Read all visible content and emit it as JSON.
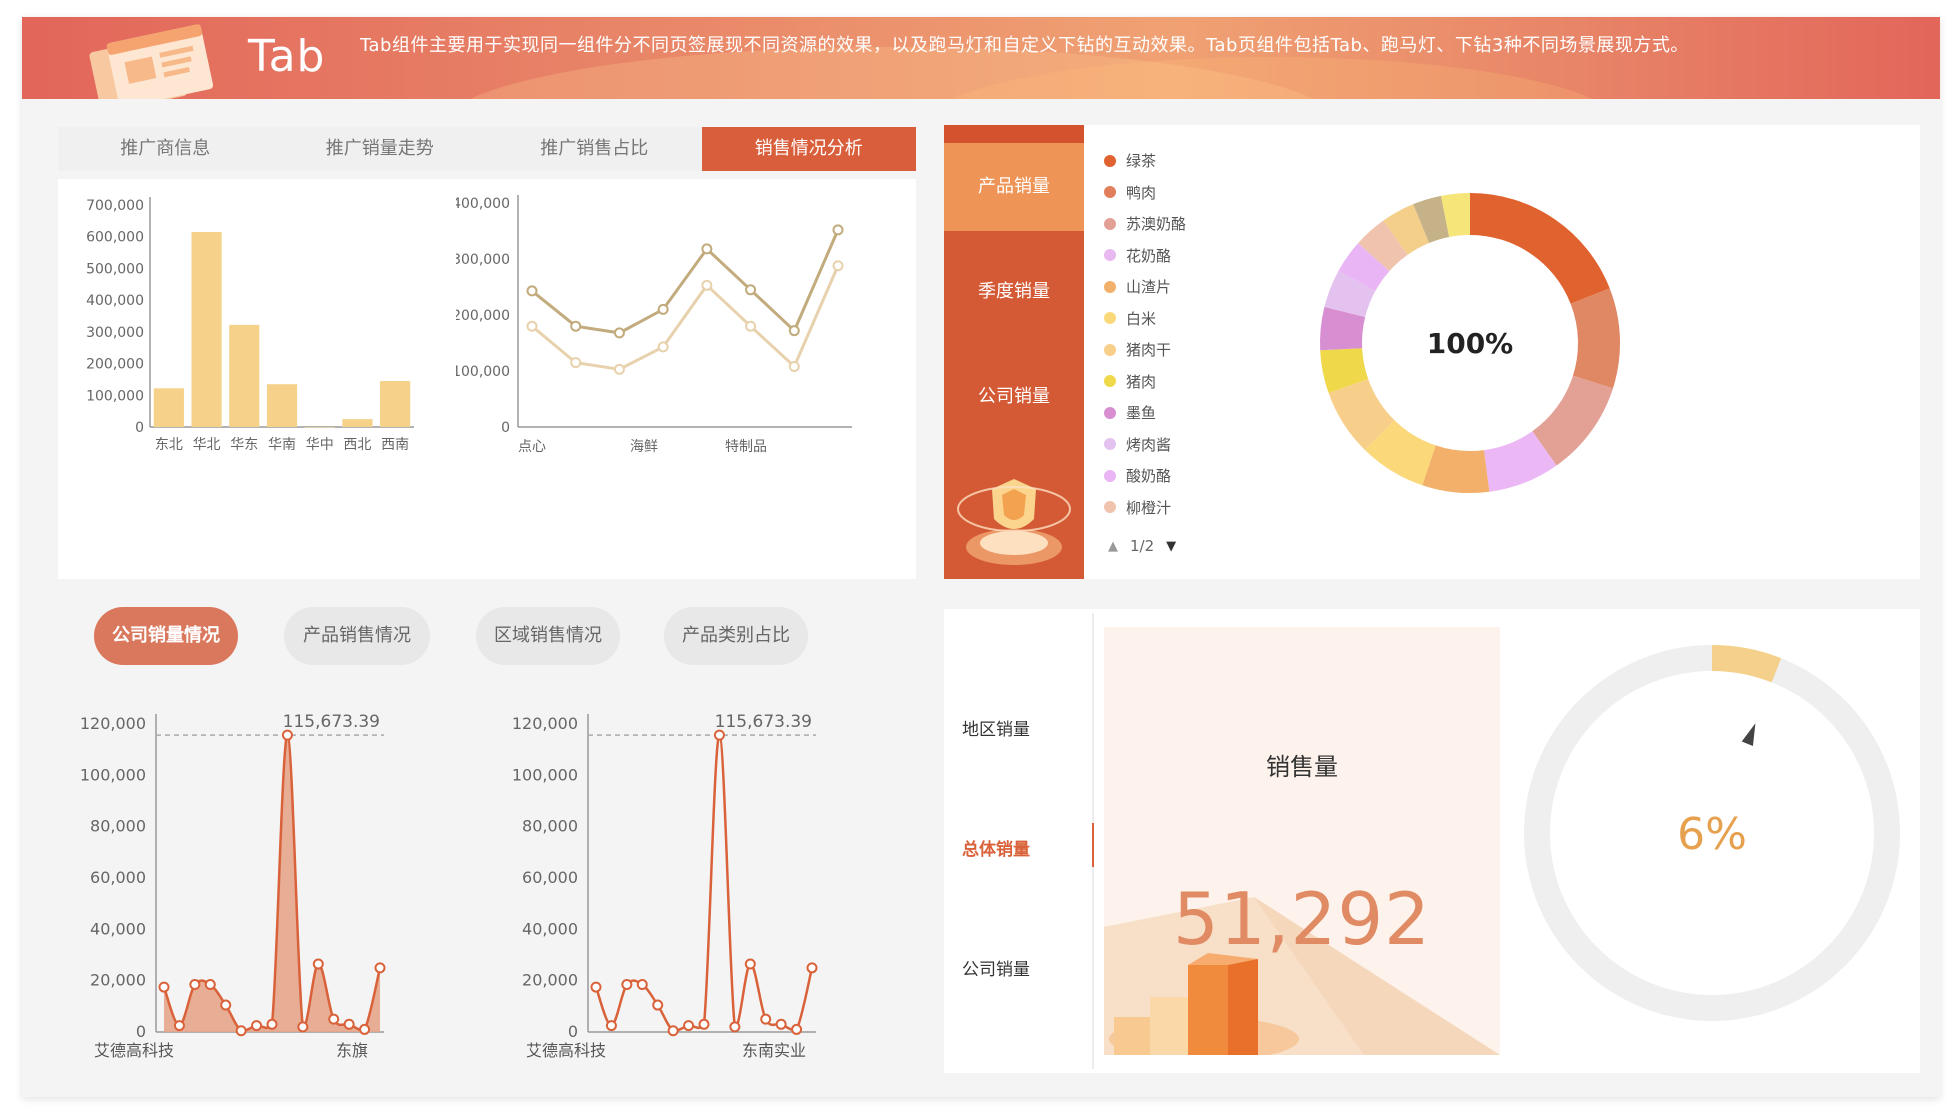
{
  "header": {
    "title": "Tab",
    "description": "Tab组件主要用于实现同一组件分不同页签展现不同资源的效果，以及跑马灯和自定义下钻的互动效果。Tab页组件包括Tab、跑马灯、下钻3种不同场景展现方式。"
  },
  "tabs": {
    "items": [
      "推广商信息",
      "推广销量走势",
      "推广销售占比",
      "销售情况分析"
    ],
    "active_index": 3
  },
  "side_menu": {
    "items": [
      "产品销量",
      "季度销量",
      "公司销量"
    ],
    "active_index": 0
  },
  "donut_legend": {
    "items": [
      {
        "label": "绿茶",
        "color": "#e0622f"
      },
      {
        "label": "鸭肉",
        "color": "#e07f5a"
      },
      {
        "label": "苏澳奶酪",
        "color": "#e3a196"
      },
      {
        "label": "花奶酪",
        "color": "#e8b8f0"
      },
      {
        "label": "山渣片",
        "color": "#f3b06a"
      },
      {
        "label": "白米",
        "color": "#fbd97a"
      },
      {
        "label": "猪肉干",
        "color": "#f7cf8a"
      },
      {
        "label": "猪肉",
        "color": "#efd84a"
      },
      {
        "label": "墨鱼",
        "color": "#d88fd2"
      },
      {
        "label": "烤肉酱",
        "color": "#e4c2ef"
      },
      {
        "label": "酸奶酪",
        "color": "#e9b5f5"
      },
      {
        "label": "柳橙汁",
        "color": "#efc3ad"
      }
    ],
    "pager": "1/2",
    "prev_icon": "triangle-up-icon",
    "next_icon": "triangle-down-icon"
  },
  "donut": {
    "center_label": "100%",
    "segments": [
      {
        "value": 18.5,
        "color": "#e0622f"
      },
      {
        "value": 10.5,
        "color": "#e08763"
      },
      {
        "value": 10.0,
        "color": "#e3a196"
      },
      {
        "value": 7.5,
        "color": "#ebb7f5"
      },
      {
        "value": 7.0,
        "color": "#f3b06a"
      },
      {
        "value": 7.0,
        "color": "#fbd97a"
      },
      {
        "value": 7.0,
        "color": "#f7cf8a"
      },
      {
        "value": 4.5,
        "color": "#efd84a"
      },
      {
        "value": 4.5,
        "color": "#d88fd2"
      },
      {
        "value": 4.0,
        "color": "#e4c2ef"
      },
      {
        "value": 3.5,
        "color": "#e9b5f5"
      },
      {
        "value": 3.5,
        "color": "#efc3ad"
      },
      {
        "value": 3.5,
        "color": "#f3cf8a"
      },
      {
        "value": 3.0,
        "color": "#c6b289"
      },
      {
        "value": 3.0,
        "color": "#f6e67a"
      }
    ]
  },
  "pills": {
    "items": [
      "公司销量情况",
      "产品销售情况",
      "区域销售情况",
      "产品类别占比"
    ],
    "active_index": 0
  },
  "vmenu": {
    "items": [
      "地区销量",
      "总体销量",
      "公司销量"
    ],
    "active_index": 1
  },
  "kpi": {
    "title": "销售量",
    "value": "51,292"
  },
  "gauge": {
    "percent": 6,
    "label": "6%"
  },
  "chart_data": [
    {
      "type": "bar",
      "categories": [
        "东北",
        "华北",
        "华东",
        "华南",
        "华中",
        "西北",
        "西南"
      ],
      "values": [
        122000,
        615000,
        322000,
        135000,
        0,
        25000,
        145000
      ],
      "ylim": [
        0,
        700000
      ],
      "yticks": [
        "0",
        "100,000",
        "200,000",
        "300,000",
        "400,000",
        "500,000",
        "600,000",
        "700,000"
      ],
      "color": "#f5d18a"
    },
    {
      "type": "line",
      "x_labels": [
        "点心",
        "海鲜",
        "特制品"
      ],
      "x_label_positions": [
        0,
        3,
        6
      ],
      "ylim": [
        0,
        400000
      ],
      "yticks": [
        "0",
        "100,000",
        "200,000",
        "300,000",
        "400,000"
      ],
      "series": [
        {
          "color": "#c2ab7c",
          "values": [
            243000,
            180000,
            168000,
            210000,
            318000,
            245000,
            172000,
            352000
          ]
        },
        {
          "color": "#e8d2ad",
          "values": [
            180000,
            115000,
            103000,
            143000,
            253000,
            180000,
            108000,
            288000
          ]
        }
      ]
    },
    {
      "type": "area",
      "x_labels": [
        "艾德高科技",
        "东旗"
      ],
      "ylim": [
        0,
        120000
      ],
      "yticks": [
        "0",
        "20,000",
        "40,000",
        "60,000",
        "80,000",
        "100,000",
        "120,000"
      ],
      "max_label": "115,673.39",
      "color": "#d9623a",
      "fill": "#e6a58b",
      "values": [
        17500,
        2500,
        18500,
        18500,
        10500,
        500,
        2500,
        3000,
        115673,
        2000,
        26500,
        5000,
        3000,
        1000,
        25000
      ]
    },
    {
      "type": "line",
      "x_labels": [
        "艾德高科技",
        "东南实业"
      ],
      "ylim": [
        0,
        120000
      ],
      "yticks": [
        "0",
        "20,000",
        "40,000",
        "60,000",
        "80,000",
        "100,000",
        "120,000"
      ],
      "max_label": "115,673.39",
      "color": "#d9623a",
      "values": [
        17500,
        2500,
        18500,
        18500,
        10500,
        500,
        2500,
        3000,
        115673,
        2000,
        26500,
        5000,
        3000,
        1000,
        25000
      ]
    }
  ]
}
